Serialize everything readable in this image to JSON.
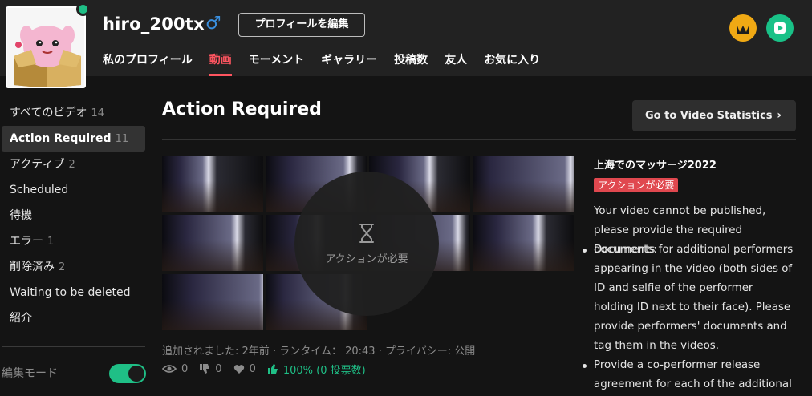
{
  "profile": {
    "username": "hiro_200tx",
    "gender_symbol": "♂",
    "edit_profile_label": "プロフィールを編集",
    "online_color": "#1fbf86",
    "avatar_icon": "pink-creature-in-box-avatar"
  },
  "nav_tabs": [
    {
      "label": "私のプロフィール",
      "active": false
    },
    {
      "label": "動画",
      "active": true
    },
    {
      "label": "モーメント",
      "active": false
    },
    {
      "label": "ギャラリー",
      "active": false
    },
    {
      "label": "投稿数",
      "active": false
    },
    {
      "label": "友人",
      "active": false
    },
    {
      "label": "お気に入り",
      "active": false
    }
  ],
  "header_icons": {
    "crown": "crown-icon",
    "play": "play-icon"
  },
  "sidebar": {
    "items": [
      {
        "label": "すべてのビデオ",
        "count": "14",
        "active": false
      },
      {
        "label": "Action Required",
        "count": "11",
        "active": true
      },
      {
        "label": "アクティブ",
        "count": "2",
        "active": false
      },
      {
        "label": "Scheduled",
        "count": "",
        "active": false
      },
      {
        "label": "待機",
        "count": "",
        "active": false
      },
      {
        "label": "エラー",
        "count": "1",
        "active": false
      },
      {
        "label": "削除済み",
        "count": "2",
        "active": false
      },
      {
        "label": "Waiting to be deleted",
        "count": "",
        "active": false
      },
      {
        "label": "紹介",
        "count": "",
        "active": false
      }
    ],
    "edit_mode_label": "編集モード",
    "edit_mode_on": true
  },
  "main": {
    "title": "Action Required",
    "stats_button_label": "Go to Video Statistics",
    "stats_button_chevron": "›"
  },
  "video": {
    "overlay_label": "アクションが必要",
    "meta": {
      "added_label": "追加されました:",
      "added_value": "2年前",
      "runtime_label": "ランタイム：",
      "runtime_value": "20:43",
      "privacy_label": "プライバシー:",
      "privacy_value": "公開"
    },
    "metrics": {
      "views": "0",
      "dislikes": "0",
      "favorites": "0",
      "rating": "100% (0 投票数)"
    },
    "title": "上海でのマッサージ2022",
    "badge": "アクションが必要",
    "description": "Your video cannot be published, please provide the required documents:",
    "requirements": [
      "Documents for additional performers appearing in the video (both sides of ID and selfie of the performer holding ID next to their face). Please provide performers' documents and tag them in the videos.",
      "Provide a co-performer release agreement for each of the additional"
    ]
  },
  "colors": {
    "accent_red": "#ff5560",
    "accent_green": "#1fbf86",
    "crown_gold": "#f0a914",
    "badge_red": "#e0484f"
  }
}
